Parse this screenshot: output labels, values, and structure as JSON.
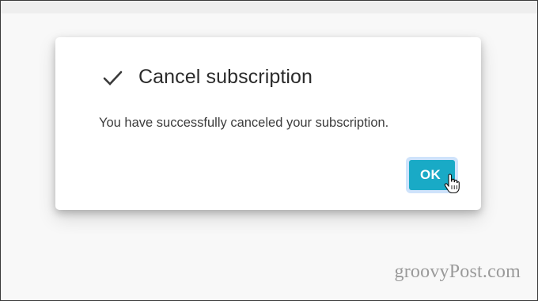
{
  "dialog": {
    "title": "Cancel subscription",
    "message": "You have successfully canceled your subscription.",
    "ok_label": "OK",
    "title_icon": "check-icon"
  },
  "cursor": {
    "icon": "hand-pointer-icon"
  },
  "watermark": {
    "text": "groovyPost.com"
  },
  "colors": {
    "ok_button_bg": "#19aac6",
    "ok_focus_ring": "#cfe3fb",
    "title_text": "#2b2b2b",
    "body_text": "#3c3c3c",
    "watermark_text": "#9a9a9a"
  }
}
